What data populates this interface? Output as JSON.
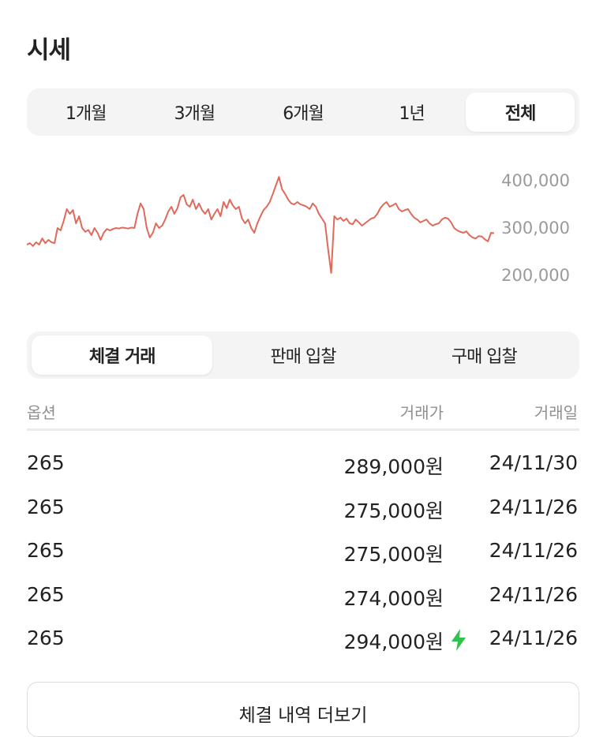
{
  "title": "시세",
  "period_tabs": [
    {
      "label": "1개월",
      "active": false
    },
    {
      "label": "3개월",
      "active": false
    },
    {
      "label": "6개월",
      "active": false
    },
    {
      "label": "1년",
      "active": false
    },
    {
      "label": "전체",
      "active": true
    }
  ],
  "chart_data": {
    "type": "line",
    "line_color": "#e0695a",
    "y_ticks": [
      "400,000",
      "300,000",
      "200,000"
    ],
    "ylim": [
      200000,
      400000
    ],
    "grid": false,
    "series": [
      {
        "values": [
          265000,
          268000,
          262000,
          270000,
          265000,
          278000,
          268000,
          275000,
          270000,
          268000,
          300000,
          295000,
          315000,
          340000,
          330000,
          338000,
          310000,
          325000,
          300000,
          292000,
          296000,
          285000,
          300000,
          290000,
          275000,
          290000,
          298000,
          295000,
          298000,
          300000,
          299000,
          301000,
          300000,
          299000,
          301000,
          300000,
          330000,
          352000,
          340000,
          300000,
          280000,
          290000,
          310000,
          300000,
          305000,
          318000,
          335000,
          345000,
          330000,
          342000,
          365000,
          370000,
          350000,
          345000,
          360000,
          340000,
          352000,
          338000,
          330000,
          340000,
          318000,
          330000,
          340000,
          325000,
          355000,
          342000,
          360000,
          348000,
          340000,
          345000,
          320000,
          310000,
          318000,
          300000,
          290000,
          310000,
          325000,
          338000,
          345000,
          355000,
          372000,
          390000,
          408000,
          382000,
          372000,
          360000,
          352000,
          350000,
          355000,
          350000,
          348000,
          345000,
          340000,
          352000,
          345000,
          330000,
          320000,
          310000,
          255000,
          205000,
          325000,
          318000,
          322000,
          315000,
          320000,
          310000,
          308000,
          318000,
          312000,
          305000,
          310000,
          315000,
          320000,
          322000,
          330000,
          342000,
          350000,
          355000,
          345000,
          348000,
          352000,
          340000,
          335000,
          338000,
          340000,
          330000,
          322000,
          318000,
          312000,
          315000,
          318000,
          310000,
          305000,
          308000,
          310000,
          318000,
          322000,
          320000,
          312000,
          300000,
          295000,
          292000,
          290000,
          293000,
          285000,
          280000,
          278000,
          283000,
          282000,
          276000,
          272000,
          290000,
          289000
        ]
      }
    ]
  },
  "transaction_tabs": [
    {
      "label": "체결 거래",
      "active": true
    },
    {
      "label": "판매 입찰",
      "active": false
    },
    {
      "label": "구매 입찰",
      "active": false
    }
  ],
  "table": {
    "headers": {
      "option": "옵션",
      "price": "거래가",
      "date": "거래일"
    },
    "rows": [
      {
        "option": "265",
        "price": "289,000원",
        "date": "24/11/30",
        "quick": false
      },
      {
        "option": "265",
        "price": "275,000원",
        "date": "24/11/26",
        "quick": false
      },
      {
        "option": "265",
        "price": "275,000원",
        "date": "24/11/26",
        "quick": false
      },
      {
        "option": "265",
        "price": "274,000원",
        "date": "24/11/26",
        "quick": false
      },
      {
        "option": "265",
        "price": "294,000원",
        "date": "24/11/26",
        "quick": true
      }
    ]
  },
  "bolt_color": "#31c24d",
  "more_button": "체결 내역 더보기"
}
